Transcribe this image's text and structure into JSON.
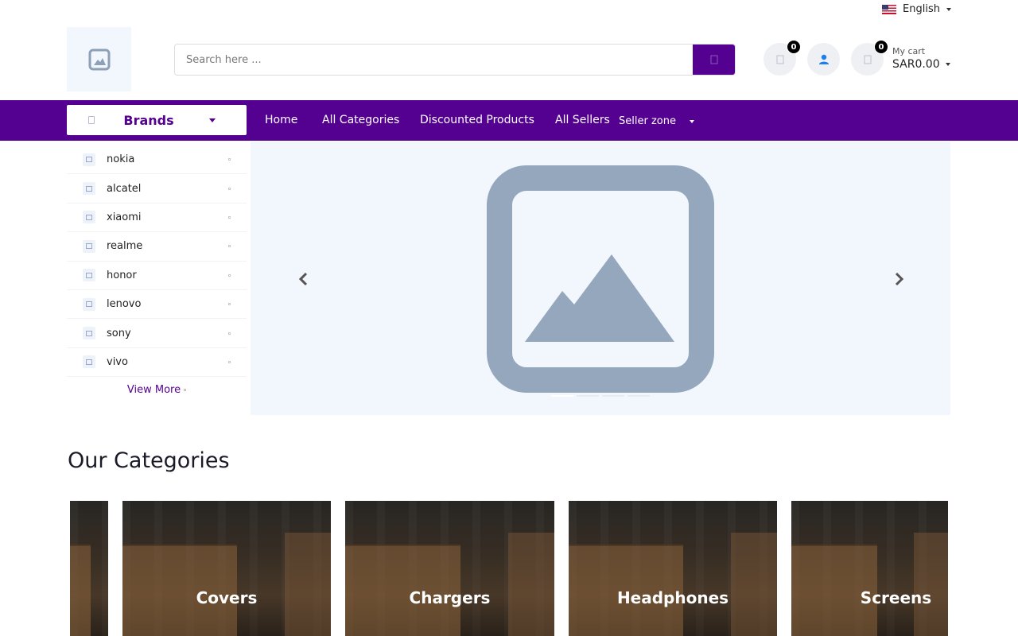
{
  "topbar": {
    "language": "English"
  },
  "header": {
    "search_placeholder": "Search here ...",
    "wishlist_count": "0",
    "cart_count": "0",
    "cart_label": "My cart",
    "cart_amount": "SAR0.00"
  },
  "nav": {
    "brands_label": "Brands",
    "links": [
      "Home",
      "All Categories",
      "Discounted Products",
      "All Sellers",
      "Seller zone"
    ]
  },
  "sidebar": {
    "items": [
      "nokia",
      "alcatel",
      "xiaomi",
      "realme",
      "honor",
      "lenovo",
      "sony",
      "vivo"
    ],
    "view_more": "View More"
  },
  "categories": {
    "title": "Our Categories",
    "items": [
      "Covers",
      "Chargers",
      "Headphones",
      "Screens"
    ]
  },
  "colors": {
    "brand": "#540091",
    "banner_bg": "#f2f6fd",
    "placeholder_icon": "#94a7bd"
  },
  "icons": {
    "search": "search-icon",
    "wishlist": "heart-icon",
    "user": "user-icon",
    "cart": "cart-icon",
    "prev": "chevron-left-icon",
    "next": "chevron-right-icon"
  }
}
